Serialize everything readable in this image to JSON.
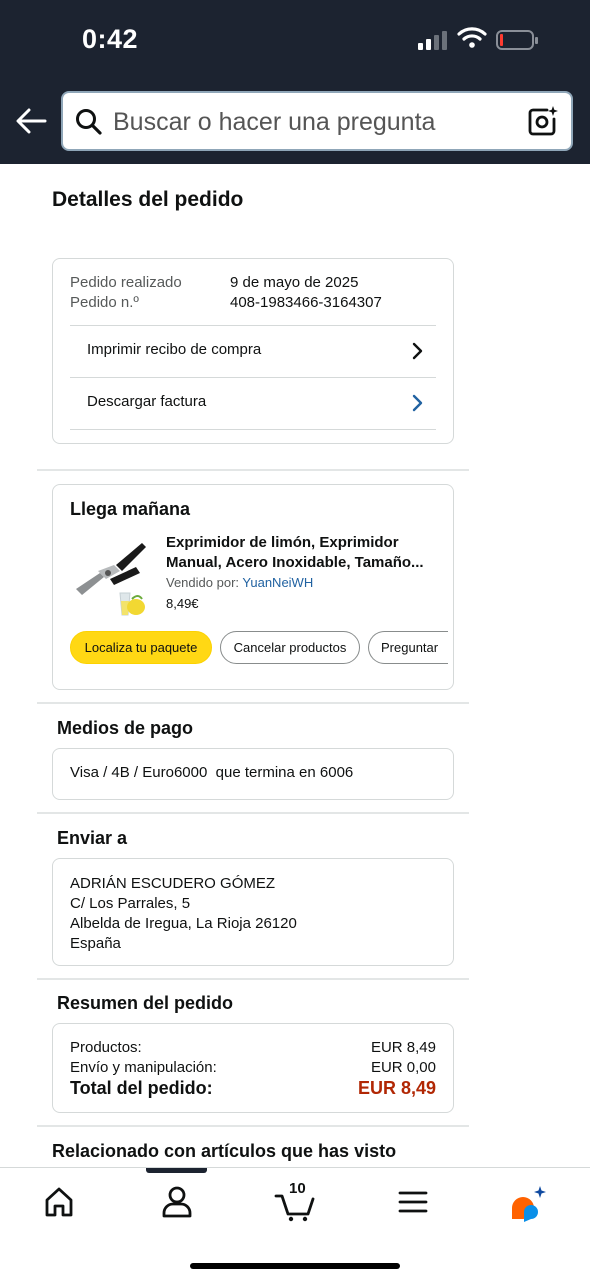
{
  "status_bar": {
    "time": "0:42"
  },
  "header": {
    "search_placeholder": "Buscar o hacer una pregunta"
  },
  "page": {
    "title": "Detalles del pedido"
  },
  "order_info": {
    "placed_label": "Pedido realizado",
    "placed_value": "9 de mayo de 2025",
    "number_label": "Pedido n.º",
    "number_value": "408-1983466-3164307",
    "print_receipt_label": "Imprimir recibo de compra",
    "download_invoice_label": "Descargar factura"
  },
  "shipment": {
    "title": "Llega mañana",
    "product_title_line1": "Exprimidor de limón, Exprimidor",
    "product_title_line2": "Manual, Acero Inoxidable, Tamaño...",
    "sold_by_label": "Vendido por:",
    "seller": "YuanNeiWH",
    "price": "8,49€",
    "track_button": "Localiza tu paquete",
    "cancel_button": "Cancelar productos",
    "ask_button": "Preguntar"
  },
  "payment": {
    "title": "Medios de pago",
    "method": "Visa / 4B / Euro6000  que termina en 6006"
  },
  "shipping": {
    "title": "Enviar a",
    "name": "ADRIÁN ESCUDERO GÓMEZ",
    "line1": "C/ Los Parrales, 5",
    "line2": "Albelda de Iregua, La Rioja 26120",
    "country": "España"
  },
  "summary": {
    "title": "Resumen del pedido",
    "products_label": "Productos:",
    "products_value": "EUR 8,49",
    "shipping_label": "Envío y manipulación:",
    "shipping_value": "EUR 0,00",
    "total_label": "Total del pedido:",
    "total_value": "EUR 8,49"
  },
  "related": {
    "title": "Relacionado con artículos que has visto"
  },
  "nav": {
    "cart_count": "10"
  },
  "colors": {
    "header_bg": "#1c2330",
    "primary_button": "#ffd814",
    "link": "#2162a1",
    "total_price": "#b12704",
    "accent_orange": "#ff6200",
    "accent_blue": "#0a8fe8"
  }
}
